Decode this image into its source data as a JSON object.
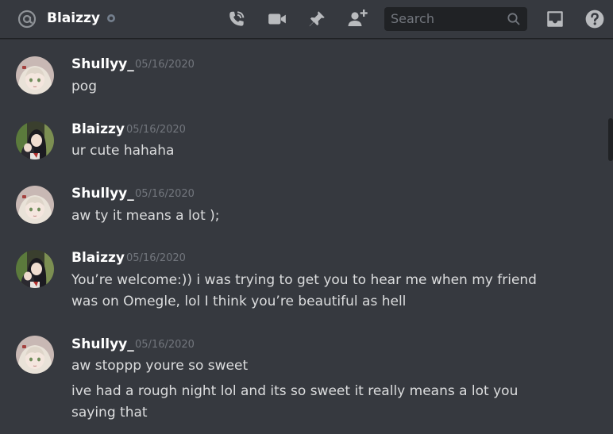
{
  "header": {
    "channel_name": "Blaizzy",
    "search_placeholder": "Search"
  },
  "icons": {
    "at": "at-icon",
    "status": "status-offline-icon",
    "call": "phone-call-icon",
    "video": "video-icon",
    "pin": "pin-icon",
    "add_friend": "add-user-icon",
    "search": "search-icon",
    "inbox": "inbox-icon",
    "help": "help-icon"
  },
  "colors": {
    "background": "#36393f",
    "header_border": "#202225",
    "author": "#ffffff",
    "text": "#dcddde",
    "timestamp": "#72767d",
    "icon": "#b9bbbe"
  },
  "messages": [
    {
      "author": "Shullyy_",
      "time": "05/16/2020",
      "lines": [
        "pog"
      ]
    },
    {
      "author": "Blaizzy",
      "time": "05/16/2020",
      "lines": [
        "ur cute hahaha"
      ]
    },
    {
      "author": "Shullyy_",
      "time": "05/16/2020",
      "lines": [
        "aw ty it means a lot );"
      ]
    },
    {
      "author": "Blaizzy",
      "time": "05/16/2020",
      "lines": [
        "You’re welcome:)) i was trying to get you to hear me when my friend was on Omegle, lol I think you’re beautiful as hell"
      ]
    },
    {
      "author": "Shullyy_",
      "time": "05/16/2020",
      "lines": [
        "aw stoppp youre so sweet",
        "ive had a rough night lol and its so sweet it really means a lot you saying that"
      ]
    }
  ]
}
